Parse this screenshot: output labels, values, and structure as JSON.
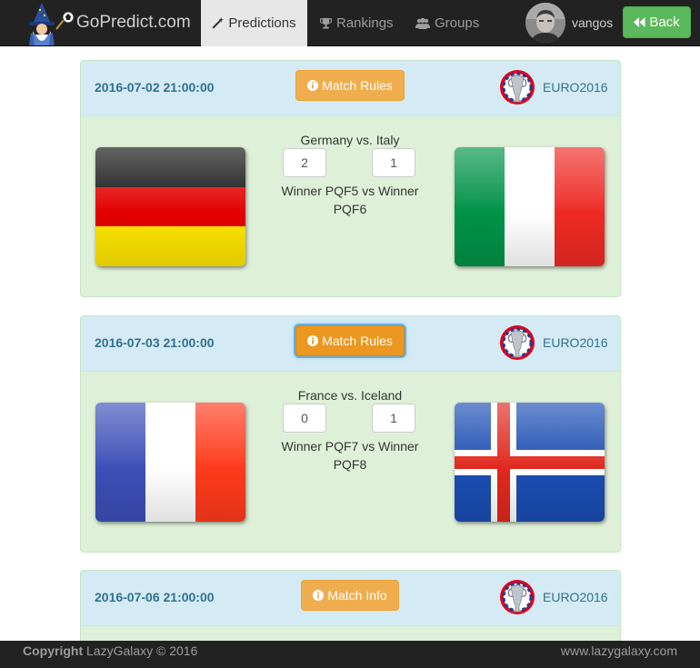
{
  "navbar": {
    "brand": "GoPredict.com",
    "items": [
      {
        "label": "Predictions",
        "icon": "magic-wand-icon",
        "active": true
      },
      {
        "label": "Rankings",
        "icon": "trophy-icon"
      },
      {
        "label": "Groups",
        "icon": "users-icon"
      }
    ],
    "username": "vangos",
    "back_label": "Back"
  },
  "matches": [
    {
      "datetime": "2016-07-02 21:00:00",
      "button": "Match Rules",
      "tournament": "EURO2016",
      "teams": "Germany vs. Italy",
      "home_score": "2",
      "away_score": "1",
      "description": "Winner PQF5 vs Winner PQF6",
      "home_flag": "germany-flag",
      "away_flag": "italy-flag"
    },
    {
      "datetime": "2016-07-03 21:00:00",
      "button": "Match Rules",
      "tournament": "EURO2016",
      "teams": "France vs. Iceland",
      "home_score": "0",
      "away_score": "1",
      "description": "Winner PQF7 vs Winner PQF8",
      "home_flag": "france-flag",
      "away_flag": "iceland-flag"
    },
    {
      "datetime": "2016-07-06 21:00:00",
      "button": "Match Info",
      "tournament": "EURO2016"
    }
  ],
  "footer": {
    "copyright_label": "Copyright",
    "copyright_text": "LazyGalaxy © 2016",
    "site": "www.lazygalaxy.com"
  },
  "colors": {
    "navbar": "#222222",
    "success": "#5cb85c",
    "warning": "#f0ad4e",
    "panel_heading": "#d4ebf6",
    "panel_body": "#dff0d8",
    "heading_text": "#31708f"
  }
}
